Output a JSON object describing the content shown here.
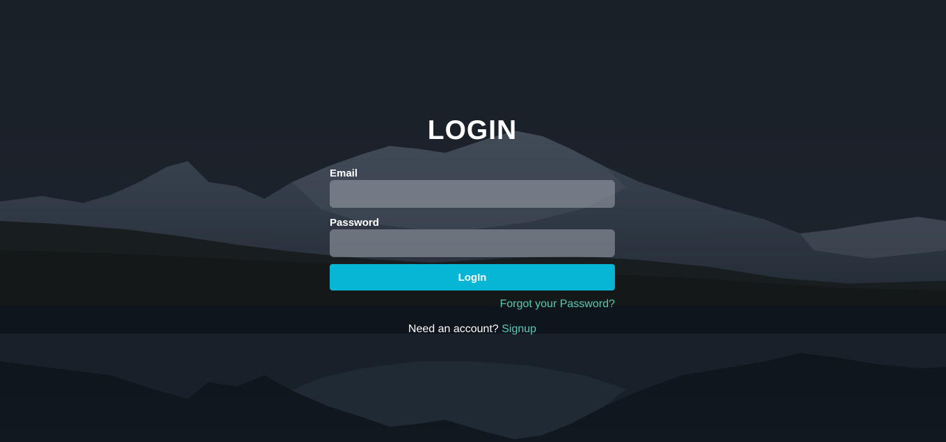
{
  "login": {
    "title": "LOGIN",
    "email_label": "Email",
    "email_value": "",
    "password_label": "Password",
    "password_value": "",
    "submit_label": "LogIn",
    "forgot_link": "Forgot your Password?",
    "signup_prompt": "Need an account?",
    "signup_link": "Signup"
  },
  "colors": {
    "accent": "#06b6d4",
    "link": "#5cc8b4",
    "background": "#1c222b"
  }
}
